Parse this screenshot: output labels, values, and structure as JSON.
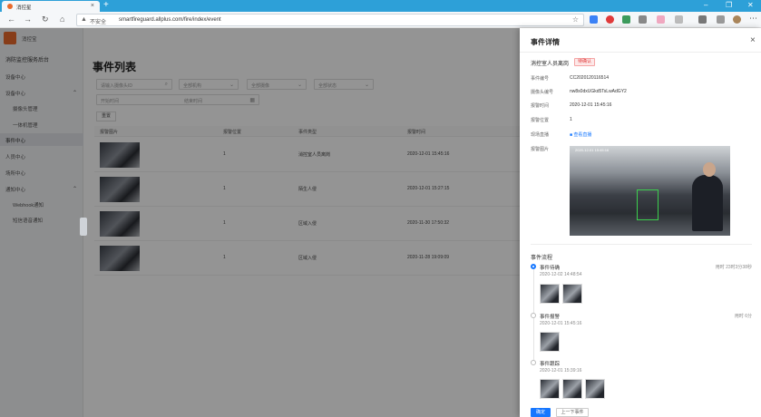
{
  "browser": {
    "tab_title": "消控星",
    "tab_close": "×",
    "new_tab": "+",
    "url_insecure": "不安全",
    "url": "smartfireguard.allplus.com/fire/index/event",
    "win_min": "–",
    "win_max": "❐",
    "win_close": "✕"
  },
  "sidebar": {
    "brand": "消控宝",
    "system_title": "消防监控服务后台",
    "items": [
      {
        "label": "设备中心",
        "indent": false,
        "chevron": ""
      },
      {
        "label": "设备中心",
        "indent": false,
        "chevron": "⌃"
      },
      {
        "label": "摄像头管理",
        "indent": true,
        "chevron": ""
      },
      {
        "label": "一体机管理",
        "indent": true,
        "chevron": ""
      },
      {
        "label": "事件中心",
        "indent": false,
        "chevron": "",
        "active": true
      },
      {
        "label": "人员中心",
        "indent": false,
        "chevron": ""
      },
      {
        "label": "场所中心",
        "indent": false,
        "chevron": ""
      },
      {
        "label": "通知中心",
        "indent": false,
        "chevron": "⌃"
      },
      {
        "label": "Webhook通知",
        "indent": true,
        "chevron": ""
      },
      {
        "label": "短信语音通知",
        "indent": true,
        "chevron": ""
      }
    ]
  },
  "main": {
    "title": "事件列表",
    "filters": {
      "search_placeholder": "请输入摄像头ID",
      "f1": "全部机构",
      "f2": "全部摄像",
      "f3": "全部状态",
      "start": "开始时间",
      "end": "结束时间"
    },
    "reset": "重置",
    "headers": [
      "报警图片",
      "报警位置",
      "事件类型",
      "报警时间"
    ],
    "rows": [
      {
        "position": "1",
        "type": "消控室人员离岗",
        "time": "2020-12-01 15:45:16"
      },
      {
        "position": "1",
        "type": "陌生人侵",
        "time": "2020-12-01 15:27:15"
      },
      {
        "position": "1",
        "type": "区域入侵",
        "time": "2020-11-30 17:50:32"
      },
      {
        "position": "1",
        "type": "区域入侵",
        "time": "2020-11-28 19:09:09"
      }
    ]
  },
  "drawer": {
    "title": "事件详情",
    "close": "×",
    "event_name": "消控室人员离岗",
    "badge": "待确认",
    "fields": [
      {
        "k": "事件编号",
        "v": "CC2020120116514"
      },
      {
        "k": "摄像头编号",
        "v": "nw8s0dxUGkd5TsLwAdGY2"
      },
      {
        "k": "报警时间",
        "v": "2020-12-01 15:45:16"
      },
      {
        "k": "报警位置",
        "v": "1"
      }
    ],
    "live_label": "现场直播",
    "live_link": "查看直播",
    "snap_label": "报警图片",
    "snap_ts": "2020-12-01 15:45:16",
    "flow_title": "事件流程",
    "flow": [
      {
        "title": "事件待确",
        "time": "2020-12-02 14:48:54",
        "dur": "用时 23时3分38秒",
        "active": true,
        "thumbs": 2
      },
      {
        "title": "事件报警",
        "time": "2020-12-01 15:45:16",
        "dur": "用时 6分",
        "active": false,
        "thumbs": 1
      },
      {
        "title": "事件跟踪",
        "time": "2020-12-01 15:39:16",
        "dur": "",
        "active": false,
        "thumbs": 3
      }
    ],
    "confirm": "确定",
    "next": "上一下事件"
  }
}
